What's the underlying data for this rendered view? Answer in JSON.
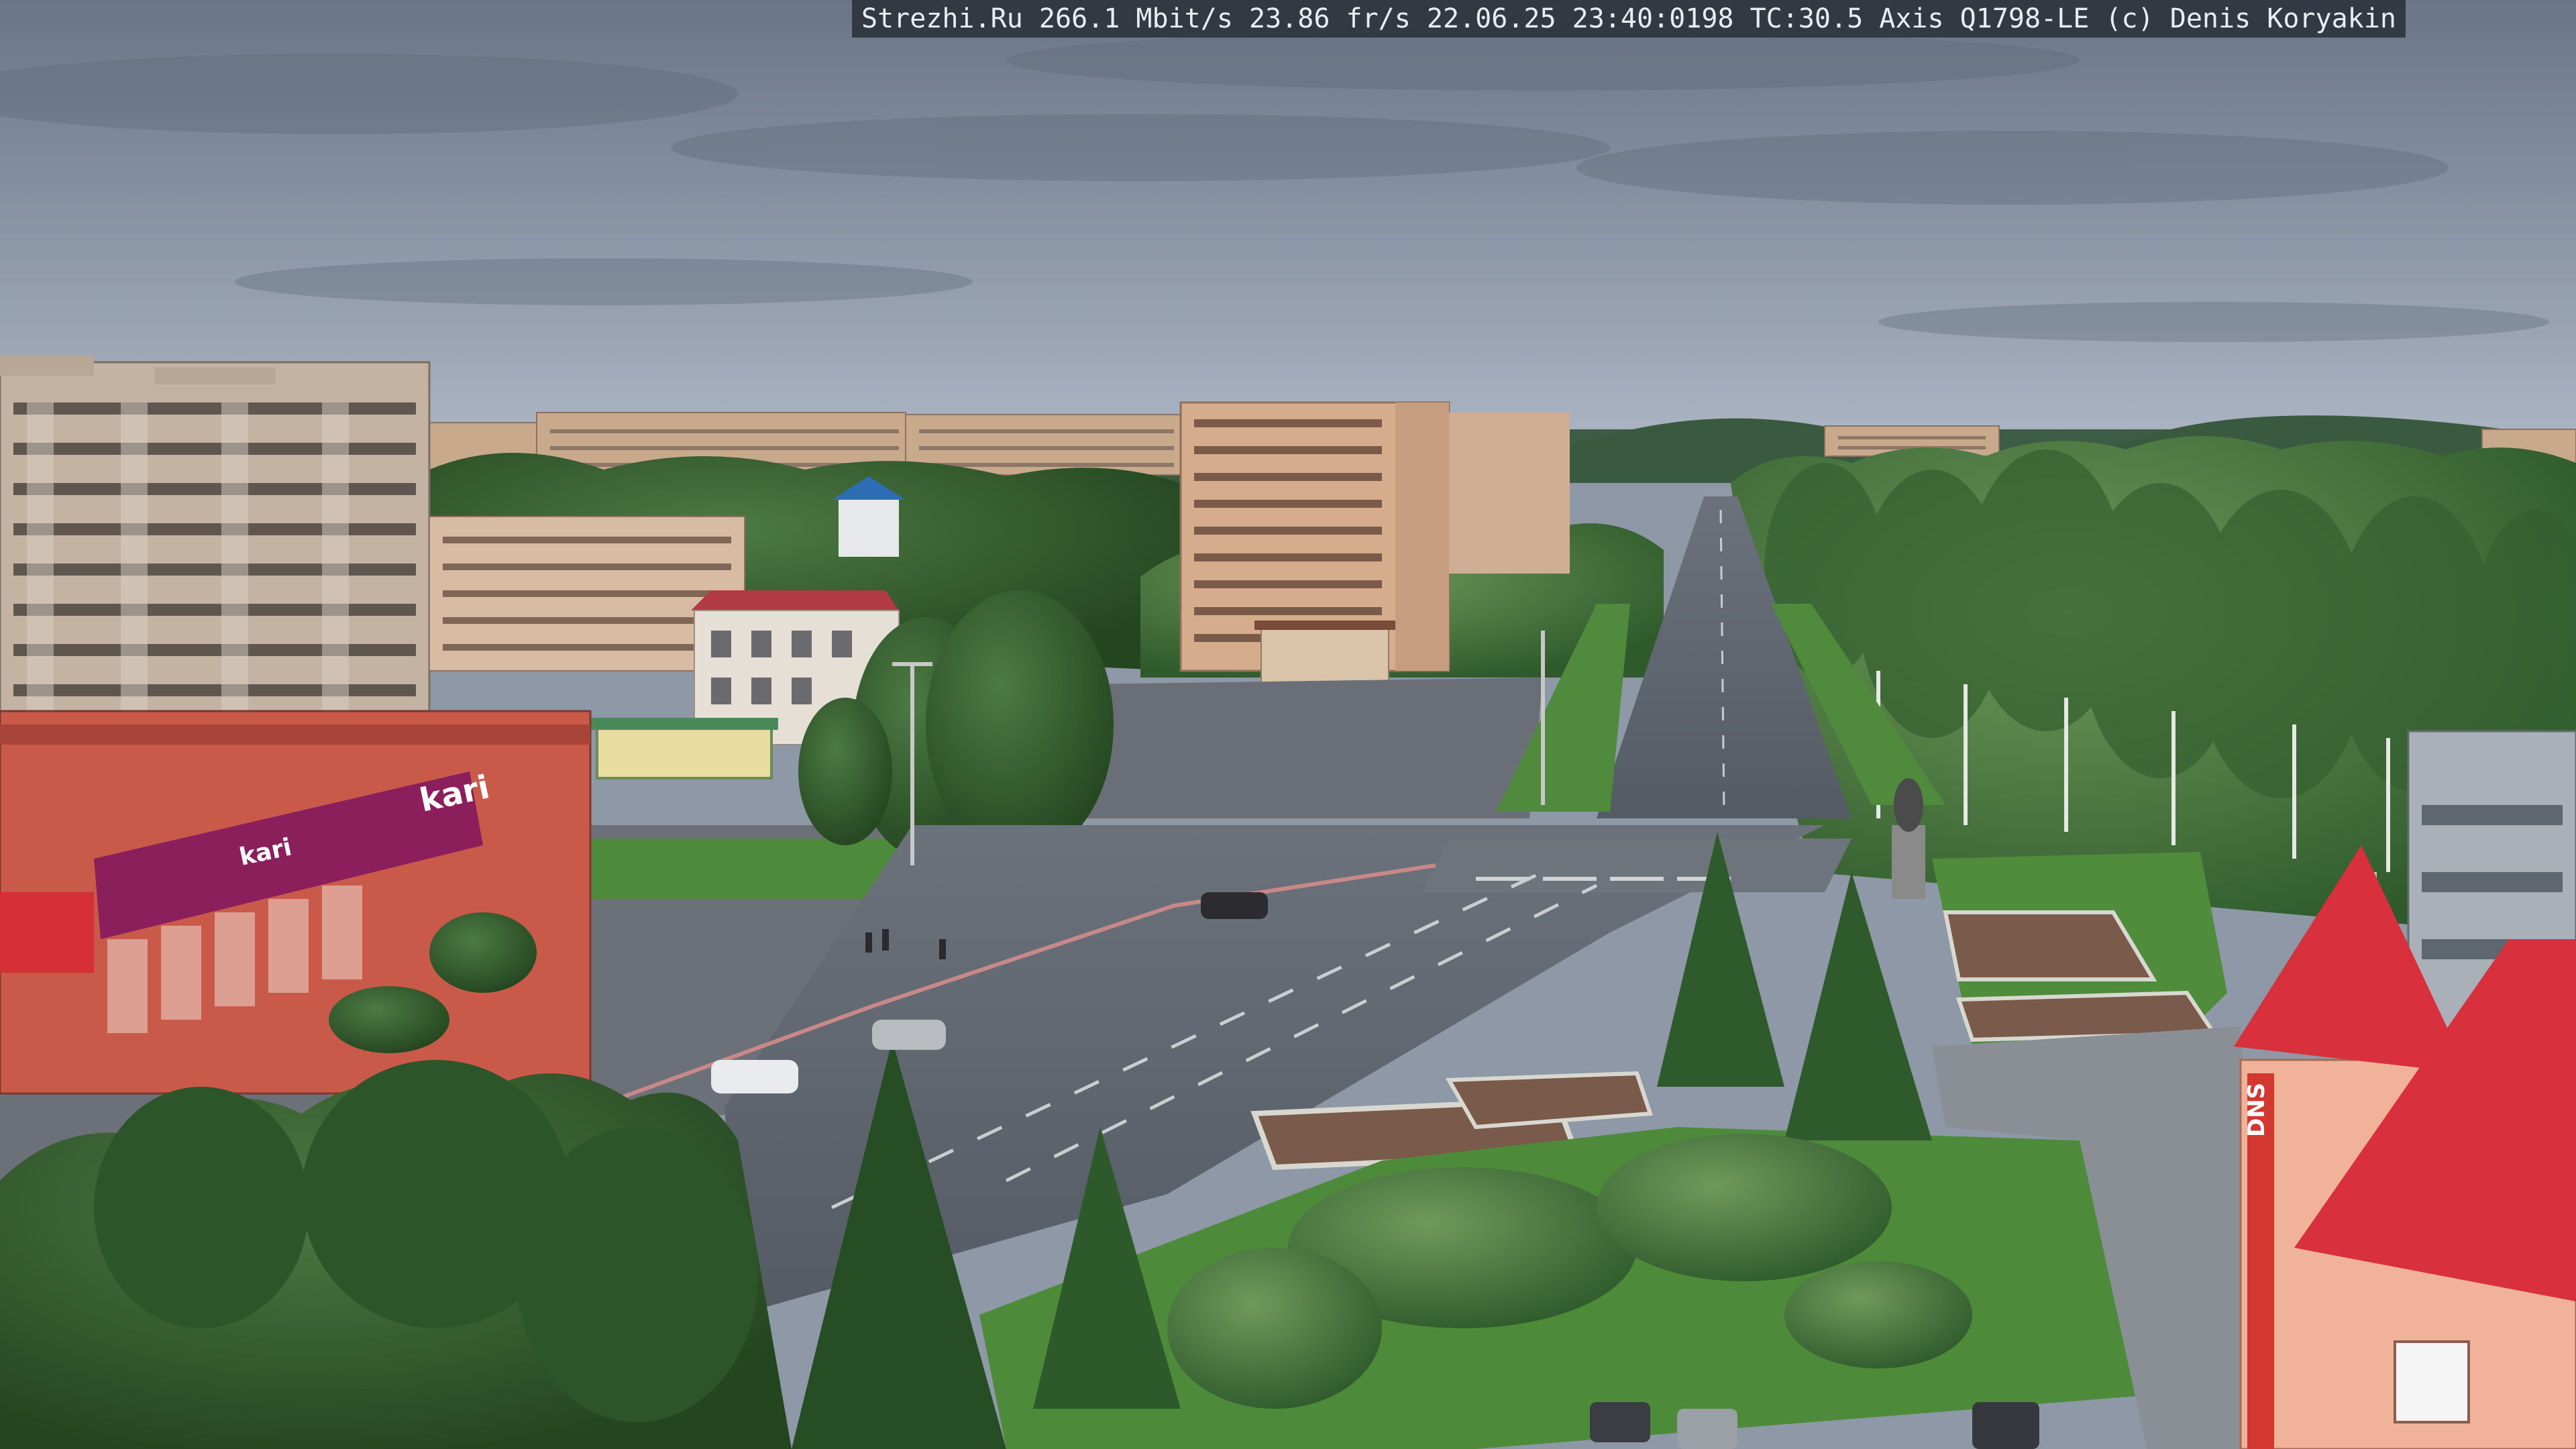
{
  "overlay": {
    "site": "Strezhi.Ru",
    "bitrate": "266.1 Mbit/s",
    "framerate": "23.86 fr/s",
    "datetime": "22.06.25 23:40:0198",
    "tc": "TC:30.5",
    "camera": "Axis Q1798-LE",
    "credit": "(c) Denis Koryakin"
  },
  "scene": {
    "signs": {
      "store_left": "kari",
      "store_left_small": "kari",
      "store_right": "DNS"
    },
    "colors": {
      "sky_top": "#6f7a8c",
      "sky_bottom": "#a9b3c2",
      "forest": "#3f6b3a",
      "road": "#5d646e",
      "roof_red": "#d8303c",
      "store_magenta": "#8a1f5c"
    }
  }
}
